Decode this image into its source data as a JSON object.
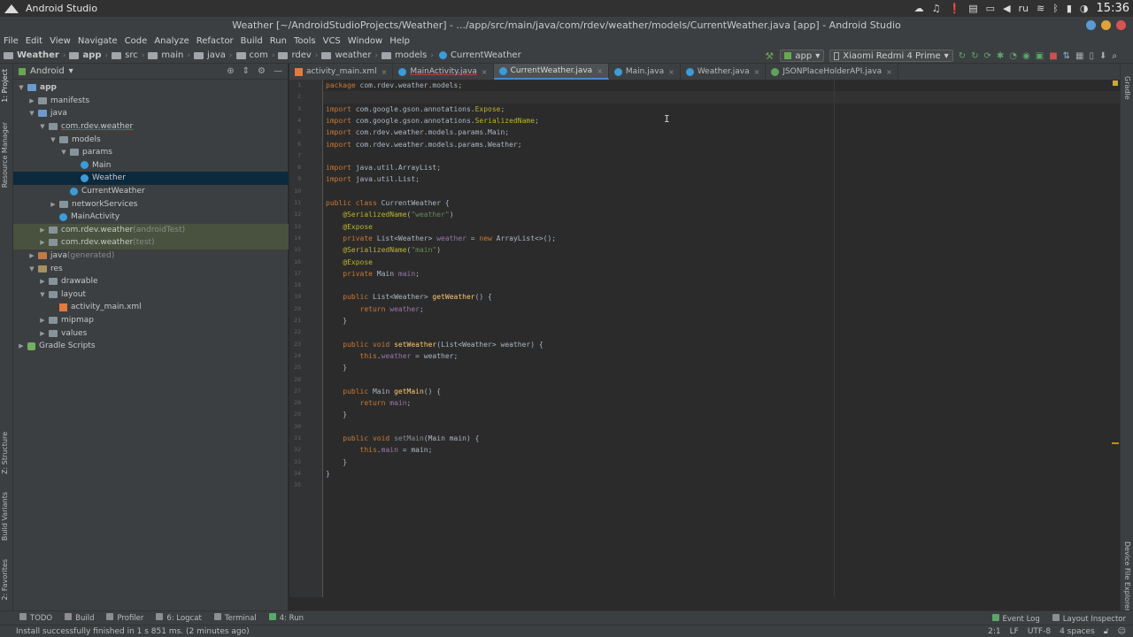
{
  "os_bar": {
    "app_name": "Android Studio",
    "lang": "ru",
    "clock": "15:36"
  },
  "title": "Weather [~/AndroidStudioProjects/Weather] - .../app/src/main/java/com/rdev/weather/models/CurrentWeather.java [app] - Android Studio",
  "menu": [
    "File",
    "Edit",
    "View",
    "Navigate",
    "Code",
    "Analyze",
    "Refactor",
    "Build",
    "Run",
    "Tools",
    "VCS",
    "Window",
    "Help"
  ],
  "breadcrumb": [
    "Weather",
    "app",
    "src",
    "main",
    "java",
    "com",
    "rdev",
    "weather",
    "models",
    "CurrentWeather"
  ],
  "toolbar": {
    "config": "app",
    "device": "Xiaomi Redmi 4 Prime"
  },
  "project_panel": {
    "view": "Android",
    "tree": [
      {
        "label": "app",
        "extra": "",
        "kind": "folder-app",
        "depth": 0,
        "arrow": "▼"
      },
      {
        "label": "manifests",
        "extra": "",
        "kind": "folder",
        "depth": 1,
        "arrow": "▶"
      },
      {
        "label": "java",
        "extra": "",
        "kind": "folder-src",
        "depth": 1,
        "arrow": "▼"
      },
      {
        "label": "com.rdev.weather",
        "extra": "",
        "kind": "folder",
        "depth": 2,
        "arrow": "▼",
        "underline": true
      },
      {
        "label": "models",
        "extra": "",
        "kind": "folder",
        "depth": 3,
        "arrow": "▼"
      },
      {
        "label": "params",
        "extra": "",
        "kind": "folder",
        "depth": 4,
        "arrow": "▼"
      },
      {
        "label": "Main",
        "extra": "",
        "kind": "class",
        "depth": 5,
        "arrow": ""
      },
      {
        "label": "Weather",
        "extra": "",
        "kind": "class",
        "depth": 5,
        "arrow": "",
        "selected": true
      },
      {
        "label": "CurrentWeather",
        "extra": "",
        "kind": "class",
        "depth": 4,
        "arrow": ""
      },
      {
        "label": "networkServices",
        "extra": "",
        "kind": "folder",
        "depth": 3,
        "arrow": "▶"
      },
      {
        "label": "MainActivity",
        "extra": "",
        "kind": "class",
        "depth": 3,
        "arrow": ""
      },
      {
        "label": "com.rdev.weather",
        "extra": "(androidTest)",
        "kind": "folder",
        "depth": 2,
        "arrow": "▶",
        "test": true
      },
      {
        "label": "com.rdev.weather",
        "extra": "(test)",
        "kind": "folder",
        "depth": 2,
        "arrow": "▶",
        "test": true
      },
      {
        "label": "java",
        "extra": "(generated)",
        "kind": "folder-gen",
        "depth": 1,
        "arrow": "▶"
      },
      {
        "label": "res",
        "extra": "",
        "kind": "folder-res",
        "depth": 1,
        "arrow": "▼"
      },
      {
        "label": "drawable",
        "extra": "",
        "kind": "folder",
        "depth": 2,
        "arrow": "▶"
      },
      {
        "label": "layout",
        "extra": "",
        "kind": "folder",
        "depth": 2,
        "arrow": "▼"
      },
      {
        "label": "activity_main.xml",
        "extra": "",
        "kind": "xml",
        "depth": 3,
        "arrow": ""
      },
      {
        "label": "mipmap",
        "extra": "",
        "kind": "folder",
        "depth": 2,
        "arrow": "▶"
      },
      {
        "label": "values",
        "extra": "",
        "kind": "folder",
        "depth": 2,
        "arrow": "▶"
      },
      {
        "label": "Gradle Scripts",
        "extra": "",
        "kind": "gradle",
        "depth": 0,
        "arrow": "▶"
      }
    ]
  },
  "left_tabs": [
    "1: Project",
    "Resource Manager",
    "Z: Structure",
    "Build Variants",
    "2: Favorites"
  ],
  "right_tabs": [
    "Gradle",
    "Device File Explorer"
  ],
  "tabs": [
    {
      "label": "activity_main.xml",
      "icon": "xml"
    },
    {
      "label": "MainActivity.java",
      "icon": "class",
      "underline": true
    },
    {
      "label": "CurrentWeather.java",
      "icon": "class",
      "active": true
    },
    {
      "label": "Main.java",
      "icon": "class"
    },
    {
      "label": "Weather.java",
      "icon": "class"
    },
    {
      "label": "JSONPlaceHolderAPI.java",
      "icon": "iface"
    }
  ],
  "code_lines": [
    "<span class='kw'>package</span> com.rdev.weather.models;",
    "",
    "<span class='kw'>import</span> com.google.gson.annotations.<span class='an'>Expose</span>;",
    "<span class='kw'>import</span> com.google.gson.annotations.<span class='an'>SerializedName</span>;",
    "<span class='kw'>import</span> com.rdev.weather.models.params.Main;",
    "<span class='kw'>import</span> com.rdev.weather.models.params.Weather;",
    "",
    "<span class='kw'>import</span> java.util.ArrayList;",
    "<span class='kw'>import</span> java.util.List;",
    "",
    "<span class='kw'>public class</span> CurrentWeather {",
    "    <span class='an'>@SerializedName</span>(<span class='str'>\"weather\"</span>)",
    "    <span class='an'>@Expose</span>",
    "    <span class='kw'>private</span> List&lt;Weather&gt; <span class='fld'>weather</span> = <span class='kw'>new</span> ArrayList&lt;&gt;();",
    "    <span class='an'>@SerializedName</span>(<span class='str'>\"main\"</span>)",
    "    <span class='an'>@Expose</span>",
    "    <span class='kw'>private</span> Main <span class='fld'>main</span>;",
    "",
    "    <span class='kw'>public</span> List&lt;Weather&gt; <span class='fn'>getWeather</span>() {",
    "        <span class='kw'>return</span> <span class='fld'>weather</span>;",
    "    }",
    "",
    "    <span class='kw'>public void</span> <span class='fn'>setWeather</span>(List&lt;Weather&gt; weather) {",
    "        <span class='kw'>this</span>.<span class='fld'>weather</span> = weather;",
    "    }",
    "",
    "    <span class='kw'>public</span> Main <span class='fn'>getMain</span>() {",
    "        <span class='kw'>return</span> <span class='fld'>main</span>;",
    "    }",
    "",
    "    <span class='kw'>public void</span> <span class='gray-fn'>setMain</span>(Main main) {",
    "        <span class='kw'>this</span>.<span class='fld'>main</span> = main;",
    "    }",
    "}",
    ""
  ],
  "bottom_tools": [
    "TODO",
    "Build",
    "Profiler",
    "6: Logcat",
    "Terminal",
    "4: Run"
  ],
  "bottom_tools_right": [
    "Event Log",
    "Layout Inspector"
  ],
  "status": {
    "message": "Install successfully finished in 1 s 851 ms. (2 minutes ago)",
    "position": "2:1",
    "line_sep": "LF",
    "encoding": "UTF-8",
    "indent": "4 spaces"
  },
  "colors": {
    "accent": "#4a88c7",
    "selection": "#0d293e",
    "keyword": "#cc7832",
    "annotation": "#bbb529",
    "string": "#6a8759",
    "field": "#9876aa",
    "method": "#ffc66d"
  }
}
